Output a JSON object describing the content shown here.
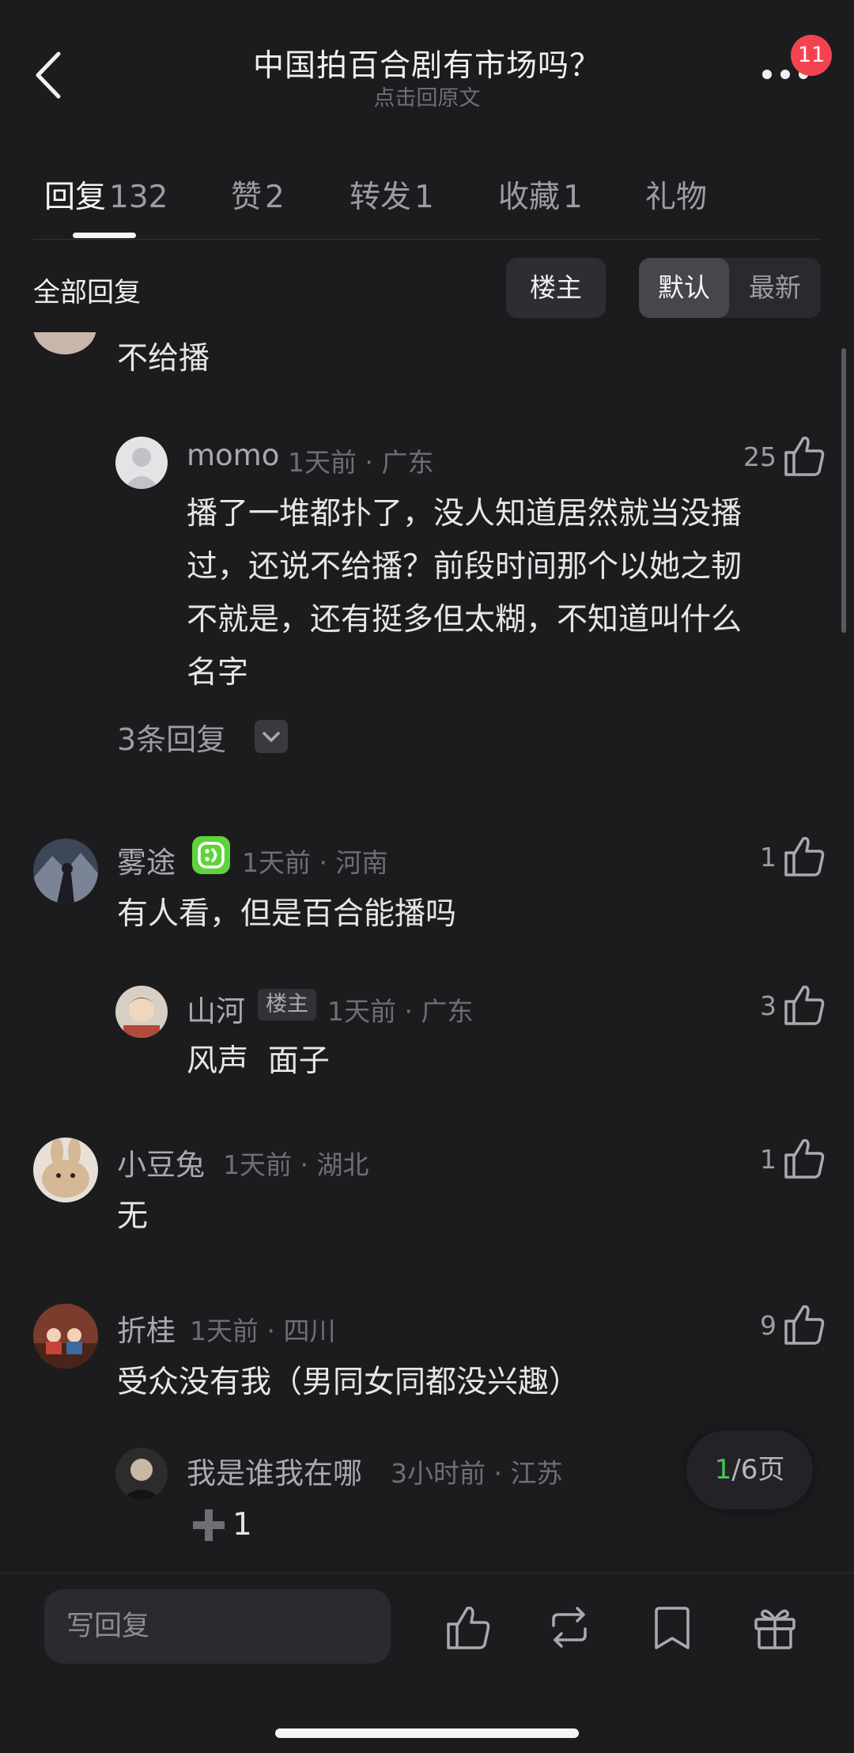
{
  "header": {
    "title": "中国拍百合剧有市场吗？",
    "subtitle": "点击回原文",
    "badge_count": "11"
  },
  "tabs": [
    {
      "label": "回复",
      "count": "132"
    },
    {
      "label": "赞",
      "count": "2"
    },
    {
      "label": "转发",
      "count": "1"
    },
    {
      "label": "收藏",
      "count": "1"
    },
    {
      "label": "礼物",
      "count": ""
    }
  ],
  "filter": {
    "label": "全部回复",
    "owner_button": "楼主",
    "sort_default": "默认",
    "sort_latest": "最新"
  },
  "comments": {
    "c0": {
      "text": "不给播"
    },
    "r0": {
      "name": "momo",
      "meta": "1天前 · 广东",
      "likes": "25",
      "text_lines": [
        "播了一堆都扑了，没人知道居然就当没播",
        "过，还说不给播？前段时间那个以她之韧",
        "不就是，还有挺多但太糊，不知道叫什么",
        "名字"
      ]
    },
    "more_replies": "3条回复",
    "c1": {
      "name": "雾途",
      "meta": "1天前 · 河南",
      "likes": "1",
      "text": "有人看，但是百合能播吗"
    },
    "r1": {
      "name": "山河",
      "tag": "楼主",
      "meta": "1天前 · 广东",
      "likes": "3",
      "text": "风声  面子"
    },
    "c2": {
      "name": "小豆兔",
      "meta": "1天前 · 湖北",
      "likes": "1",
      "text": "无"
    },
    "c3": {
      "name": "折桂",
      "meta": "1天前 · 四川",
      "likes": "9",
      "text": "受众没有我（男同女同都没兴趣）"
    },
    "r3": {
      "name": "我是谁我在哪",
      "meta": "3小时前 · 江苏",
      "text": "1"
    }
  },
  "pagination": {
    "current": "1",
    "total": "/6页"
  },
  "bottom_bar": {
    "reply_placeholder": "写回复"
  },
  "colors": {
    "background": "#1c1c1f",
    "badge": "#f4434f",
    "page_current": "#4cc35a"
  }
}
